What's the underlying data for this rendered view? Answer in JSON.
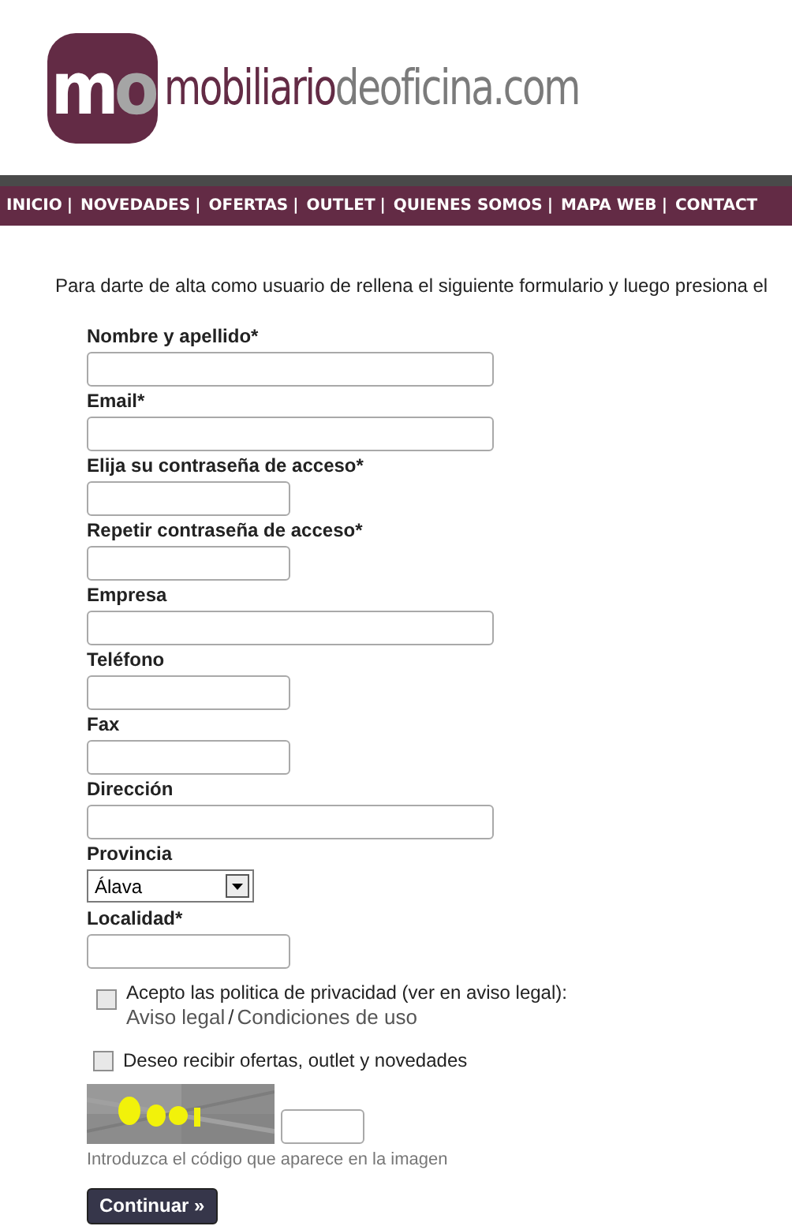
{
  "logo": {
    "mark_letters": [
      "m",
      "o"
    ],
    "name_primary": "mobiliario",
    "name_secondary": "deoficina.com"
  },
  "nav": [
    {
      "label": "INICIO",
      "separator": "|"
    },
    {
      "label": "NOVEDADES",
      "separator": "|"
    },
    {
      "label": "OFERTAS",
      "separator": "|"
    },
    {
      "label": "OUTLET",
      "separator": "|"
    },
    {
      "label": "QUIENES SOMOS",
      "separator": "|"
    },
    {
      "label": "MAPA WEB",
      "separator": "|"
    },
    {
      "label": "CONTACT"
    }
  ],
  "intro": "Para darte de alta como usuario de rellena el siguiente formulario y luego presiona el",
  "fields": [
    {
      "label": "Nombre y apellido*",
      "kind": "wide"
    },
    {
      "label": "Email*",
      "kind": "wide"
    },
    {
      "label": "Elija su contraseña de acceso*",
      "kind": "narrow"
    },
    {
      "label": "Repetir contraseña de acceso*",
      "kind": "narrow"
    },
    {
      "label": "Empresa",
      "kind": "wide"
    },
    {
      "label": "Teléfono",
      "kind": "narrow"
    },
    {
      "label": "Fax",
      "kind": "narrow"
    },
    {
      "label": "Dirección",
      "kind": "wide"
    },
    {
      "label": "Provincia",
      "kind": "select",
      "value": "Álava"
    },
    {
      "label": "Localidad*",
      "kind": "narrow"
    }
  ],
  "privacy": {
    "checked": false,
    "text": "Acepto las politica de privacidad (ver en aviso legal):",
    "link_1": "Aviso legal",
    "slash": "/",
    "link_2": "Condiciones de uso"
  },
  "newsletter": {
    "checked": false,
    "text": "Deseo recibir ofertas, outlet y novedades"
  },
  "captcha": {
    "kind": "picture",
    "hint": "Introduzca el código que aparece en la imagen"
  },
  "submit": "Continuar »"
}
